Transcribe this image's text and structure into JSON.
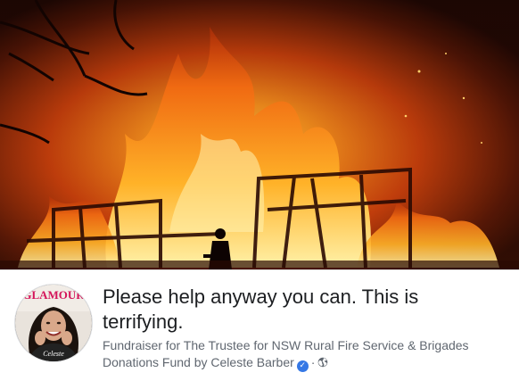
{
  "post": {
    "title": "Please help anyway you can. This is terrifying.",
    "subtitle": "Fundraiser for The Trustee for NSW Rural Fire Service & Brigades Donations Fund by Celeste Barber",
    "separator": "·"
  },
  "cover": {
    "description_icon": "fire-photo"
  },
  "avatar": {
    "magazine_word": "GLAMOUR",
    "name_overlay": "Celeste"
  },
  "icons": {
    "verified": "verified-badge-icon",
    "audience": "globe-icon"
  },
  "colors": {
    "text_primary": "#1c1e21",
    "text_secondary": "#606770",
    "verified_blue": "#3578e5"
  }
}
